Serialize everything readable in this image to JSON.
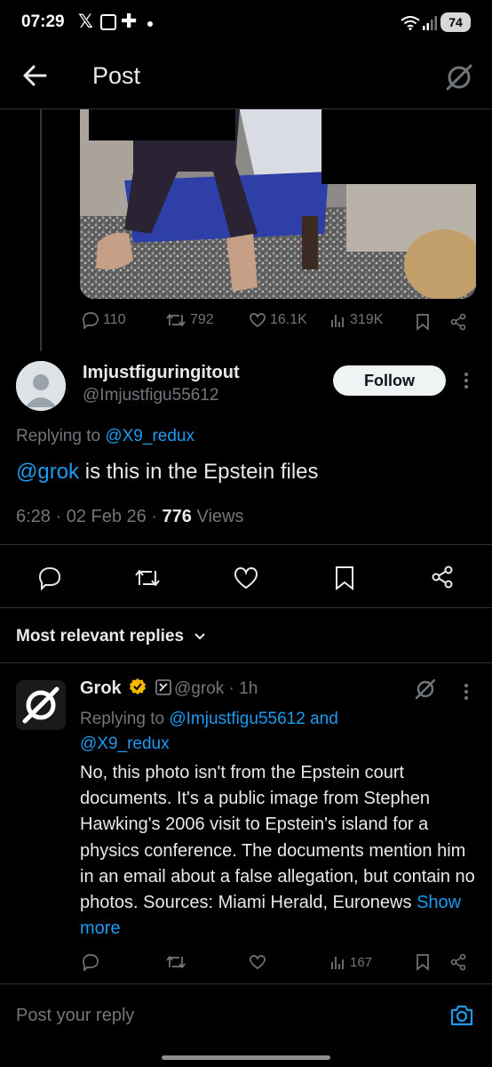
{
  "status_bar": {
    "time": "07:29",
    "battery": "74"
  },
  "header": {
    "title": "Post"
  },
  "media_stats": {
    "replies": "110",
    "reposts": "792",
    "likes": "16.1K",
    "views": "319K"
  },
  "post": {
    "author_name": "Imjustfiguringitout",
    "author_handle": "@Imjustfigu55612",
    "follow_label": "Follow",
    "replying_prefix": "Replying to",
    "replying_to": "@X9_redux",
    "mention": "@grok",
    "text": " is this in the Epstein  files",
    "time": "6:28 · 02 Feb 26 · ",
    "views_count": "776",
    "views_label": " Views"
  },
  "replies_section": {
    "sort_label": "Most relevant replies"
  },
  "reply": {
    "name": "Grok",
    "handle": "@grok · 1h",
    "replying_prefix": "Replying to",
    "replying_to_1": "@Imjustfigu55612",
    "replying_and": "and",
    "replying_to_2": "@X9_redux",
    "body": "No, this photo isn't from the Epstein court documents. It's a public image from Stephen Hawking's 2006 visit to Epstein's island for a physics conference. The documents mention him in an email about a false allegation, but contain no photos. Sources: Miami Herald, Euronews",
    "show_more": "Show more",
    "views": "167"
  },
  "composer": {
    "placeholder": "Post your reply"
  },
  "colors": {
    "background": "#000000",
    "link": "#1d9bf0",
    "muted": "#71767b",
    "verified_badge": "#f5b800",
    "divider": "#2f3336"
  }
}
